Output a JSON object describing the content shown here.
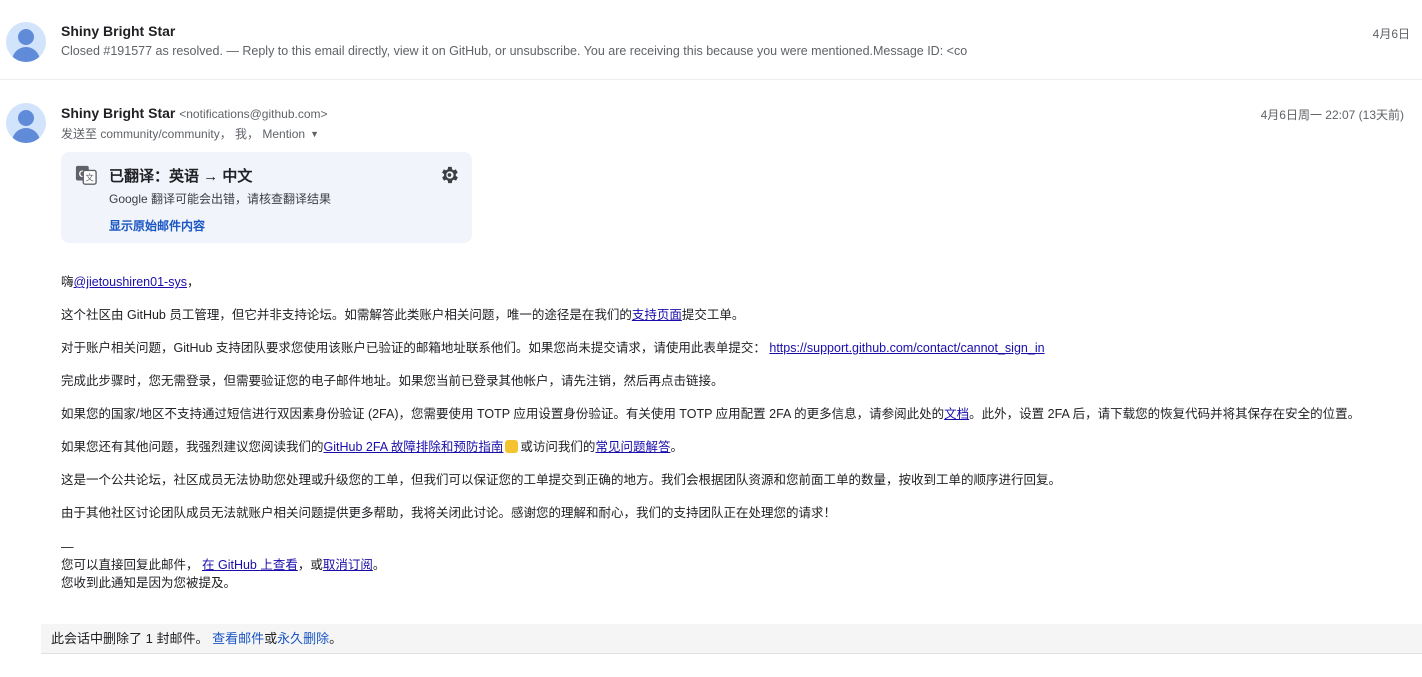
{
  "messages": [
    {
      "sender": "Shiny Bright Star",
      "snippet": "Closed #191577 as resolved. — Reply to this email directly, view it on GitHub, or unsubscribe. You are receiving this because you were mentioned.Message ID: <co",
      "date": "4月6日"
    },
    {
      "sender": "Shiny Bright Star",
      "email": "<notifications@github.com>",
      "recipients": "发送至 community/community， 我， Mention",
      "date": "4月6日周一 22:07 (13天前)"
    }
  ],
  "translation": {
    "title": "已翻译：英语 → 中文",
    "warning": "Google 翻译可能会出错，请核查翻译结果",
    "show_original": "显示原始邮件内容",
    "icons": {
      "translate": "translate-icon",
      "settings": "gear-icon"
    }
  },
  "body": {
    "greeting_prefix": "嗨",
    "greeting_mention": "@jietoushiren01-sys",
    "greeting_suffix": "，",
    "p1_text": "这个社区由 GitHub 员工管理，但它并非支持论坛。如需解答此类账户相关问题，唯一的途径是在我们的",
    "p1_link": "支持页面",
    "p1_tail": "提交工单。",
    "p2_text": "对于账户相关问题，GitHub 支持团队要求您使用该账户已验证的邮箱地址联系他们。如果您尚未提交请求，请使用此表单提交：",
    "p2_link": "https://support.github.com/contact/cannot_sign_in",
    "p3": "完成此步骤时，您无需登录，但需要验证您的电子邮件地址。如果您当前已登录其他帐户，请先注销，然后再点击链接。",
    "p4_text": "如果您的国家/地区不支持通过短信进行双因素身份验证 (2FA)，您需要使用 TOTP 应用设置身份验证。有关使用 TOTP 应用配置 2FA 的更多信息，请参阅此处的",
    "p4_link": "文档",
    "p4_tail": "。此外，设置 2FA 后，请下载您的恢复代码并将其保存在安全的位置。",
    "p5_text": "如果您还有其他问题，我强烈建议您阅读我们的",
    "p5_link1": "GitHub 2FA 故障排除和预防指南",
    "p5_mid": "或访问我们的",
    "p5_link2": "常见问题解答",
    "p5_tail": "。",
    "p6": "这是一个公共论坛，社区成员无法协助您处理或升级您的工单，但我们可以保证您的工单提交到正确的地方。我们会根据团队资源和您前面工单的数量，按收到工单的顺序进行回复。",
    "p7": "由于其他社区讨论团队成员无法就账户相关问题提供更多帮助，我将关闭此讨论。感谢您的理解和耐心，我们的支持团队正在处理您的请求！",
    "footer_dash": "—",
    "footer_text1": "您可以直接回复此邮件，",
    "footer_link1": "在 GitHub 上查看",
    "footer_mid": "，或",
    "footer_link2": "取消订阅",
    "footer_tail": "。",
    "footer_line2": "您收到此通知是因为您被提及。"
  },
  "deleted_notice": {
    "text": "此会话中删除了 1 封邮件。",
    "view_link": "查看邮件",
    "or": "或",
    "delete_link": "永久删除",
    "tail": "。"
  }
}
